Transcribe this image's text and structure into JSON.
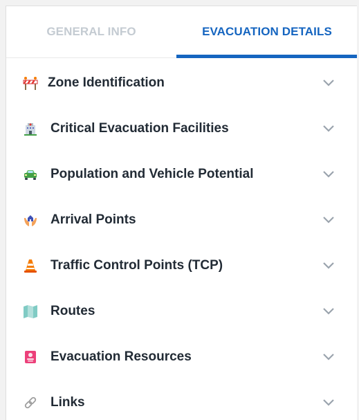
{
  "tabs": [
    {
      "label": "GENERAL INFO",
      "active": false
    },
    {
      "label": "EVACUATION DETAILS",
      "active": true
    }
  ],
  "colors": {
    "accent": "#1565c0",
    "inactive_tab": "#c4cbd2",
    "label_text": "#222b35",
    "chevron": "#9aa3ad"
  },
  "sections": [
    {
      "label": "Zone Identification",
      "icon": "construction-barrier-icon"
    },
    {
      "label": "Critical Evacuation Facilities",
      "icon": "hospital-building-icon"
    },
    {
      "label": "Population and Vehicle Potential",
      "icon": "car-icon"
    },
    {
      "label": "Arrival Points",
      "icon": "hands-house-icon"
    },
    {
      "label": "Traffic Control Points (TCP)",
      "icon": "traffic-cone-icon"
    },
    {
      "label": "Routes",
      "icon": "map-icon"
    },
    {
      "label": "Evacuation Resources",
      "icon": "id-card-icon"
    },
    {
      "label": "Links",
      "icon": "link-icon"
    }
  ]
}
